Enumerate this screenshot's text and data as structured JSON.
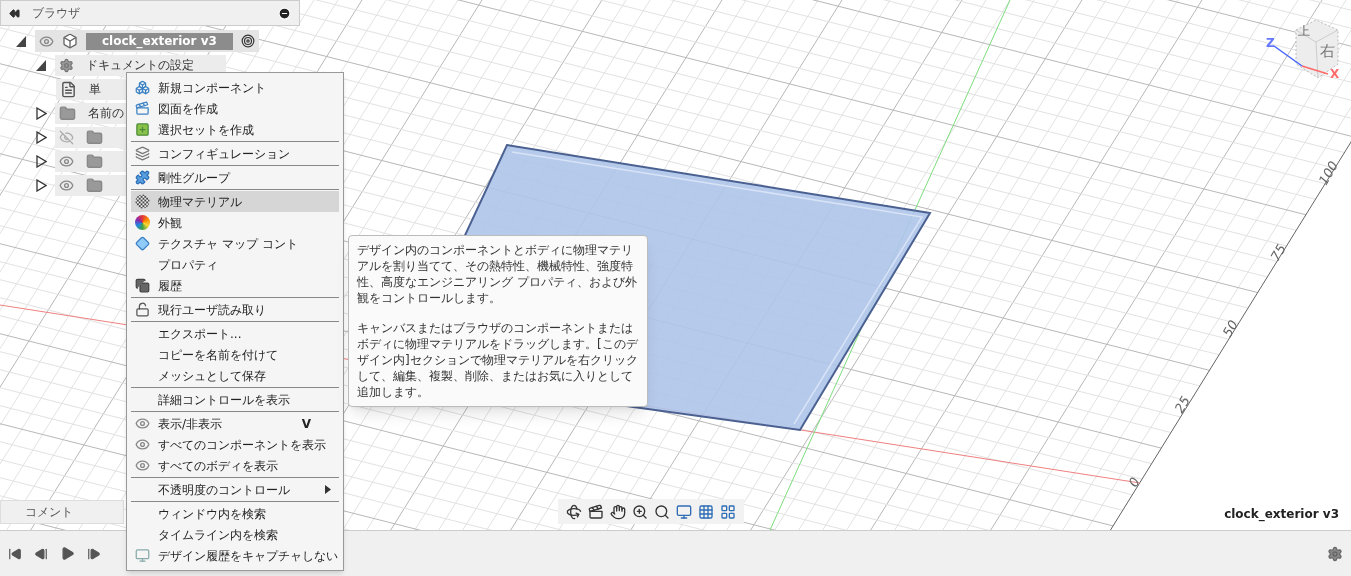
{
  "browser": {
    "title": "ブラウザ",
    "root": {
      "label": "clock_exterior v3",
      "expanded": true,
      "visible": true,
      "children": [
        {
          "kind": "settings",
          "label": "ドキュメントの設定",
          "expanded": true,
          "children": [
            {
              "kind": "document",
              "label": "単"
            }
          ]
        },
        {
          "kind": "folder",
          "label": "名前の",
          "expanded": false
        },
        {
          "kind": "folder",
          "expanded": false,
          "visible": false
        },
        {
          "kind": "folder",
          "expanded": false,
          "visible": true
        },
        {
          "kind": "folder",
          "expanded": false,
          "visible": true
        }
      ]
    }
  },
  "comments_panel": {
    "title": "コメント"
  },
  "context_menu": [
    {
      "kind": "icon",
      "label": "新規コンポーネント",
      "selected": false
    },
    {
      "kind": "icon",
      "label": "図面を作成",
      "selected": false
    },
    {
      "kind": "icon",
      "label": "選択セットを作成",
      "selected": false
    },
    {
      "kind": "separator"
    },
    {
      "kind": "icon",
      "label": "コンフィギュレーション",
      "selected": false
    },
    {
      "kind": "separator"
    },
    {
      "kind": "icon",
      "label": "剛性グループ",
      "selected": false
    },
    {
      "kind": "separator"
    },
    {
      "kind": "icon",
      "label": "物理マテリアル",
      "selected": true
    },
    {
      "kind": "icon",
      "label": "外観",
      "selected": false
    },
    {
      "kind": "icon",
      "label": "テクスチャ マップ コント",
      "selected": false
    },
    {
      "kind": "plain",
      "label": "プロパティ",
      "selected": false
    },
    {
      "kind": "icon",
      "label": "履歴",
      "selected": false
    },
    {
      "kind": "separator"
    },
    {
      "kind": "icon",
      "label": "現行ユーザ読み取り",
      "selected": false
    },
    {
      "kind": "separator"
    },
    {
      "kind": "plain",
      "label": "エクスポート...",
      "selected": false
    },
    {
      "kind": "plain",
      "label": "コピーを名前を付けて",
      "selected": false
    },
    {
      "kind": "plain",
      "label": "メッシュとして保存",
      "selected": false
    },
    {
      "kind": "separator"
    },
    {
      "kind": "plain",
      "label": "詳細コントロールを表示",
      "selected": false
    },
    {
      "kind": "separator"
    },
    {
      "kind": "icon",
      "label": "表示/非表示",
      "shortcut": "V",
      "selected": false
    },
    {
      "kind": "icon",
      "label": "すべてのコンポーネントを表示",
      "selected": false
    },
    {
      "kind": "icon",
      "label": "すべてのボディを表示",
      "selected": false
    },
    {
      "kind": "separator"
    },
    {
      "kind": "plain",
      "label": "不透明度のコントロール",
      "submenu": true,
      "selected": false
    },
    {
      "kind": "separator"
    },
    {
      "kind": "plain",
      "label": "ウィンドウ内を検索",
      "selected": false
    },
    {
      "kind": "plain",
      "label": "タイムライン内を検索",
      "selected": false
    },
    {
      "kind": "icon",
      "label": "デザイン履歴をキャプチャしない",
      "selected": false
    }
  ],
  "tooltip": {
    "paragraphs": [
      "デザイン内のコンポーネントとボディに物理マテリアルを割り当てて、その熱特性、機械特性、強度特性、高度なエンジニアリング プロパティ、および外観をコントロールします。",
      "キャンバスまたはブラウザのコンポーネントまたはボディに物理マテリアルをドラッグします。[このデザイン内]セクションで物理マテリアルを右クリックして、編集、複製、削除、またはお気に入りとして追加します。"
    ]
  },
  "viewport": {
    "axis_labels": [
      "100",
      "75",
      "50",
      "25",
      "0"
    ],
    "viewcube": {
      "faces": [
        "上",
        "右"
      ],
      "axes": [
        "Z",
        "X"
      ]
    },
    "document_name": "clock_exterior v3"
  }
}
